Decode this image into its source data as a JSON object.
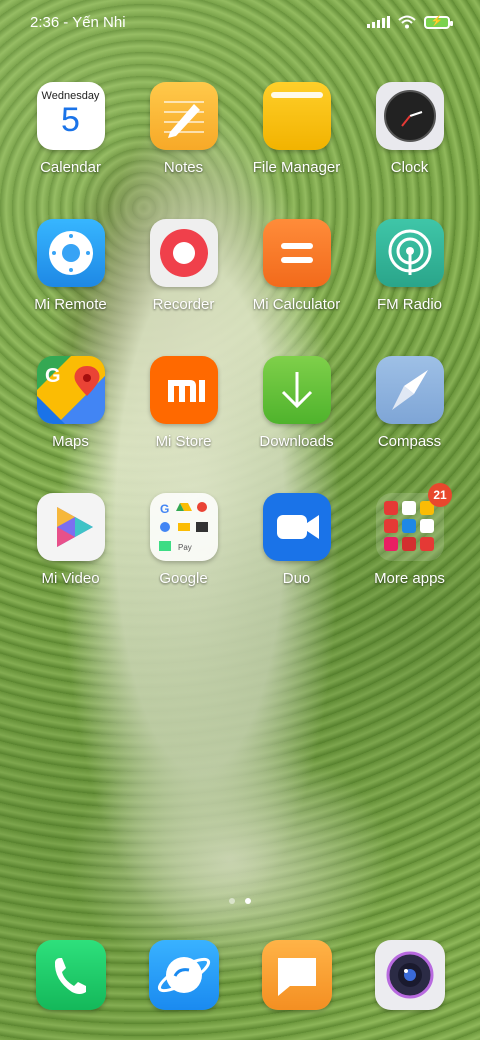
{
  "status": {
    "time": "2:36",
    "separator": "-",
    "carrier": "Yến Nhi"
  },
  "calendar": {
    "weekday": "Wednesday",
    "day": "5"
  },
  "apps": [
    {
      "label": "Calendar"
    },
    {
      "label": "Notes"
    },
    {
      "label": "File Manager"
    },
    {
      "label": "Clock"
    },
    {
      "label": "Mi Remote"
    },
    {
      "label": "Recorder"
    },
    {
      "label": "Mi Calculator"
    },
    {
      "label": "FM Radio"
    },
    {
      "label": "Maps"
    },
    {
      "label": "Mi Store"
    },
    {
      "label": "Downloads"
    },
    {
      "label": "Compass"
    },
    {
      "label": "Mi Video"
    },
    {
      "label": "Google"
    },
    {
      "label": "Duo"
    },
    {
      "label": "More apps"
    }
  ],
  "more_apps_badge": "21",
  "dock_icons": [
    "phone-icon",
    "browser-icon",
    "messages-icon",
    "camera-icon"
  ],
  "colors": {
    "phone": "#1fcf6a",
    "browser": "#1f9bf0",
    "messages": "#f7a43a",
    "camera": "#e8e8ec"
  }
}
